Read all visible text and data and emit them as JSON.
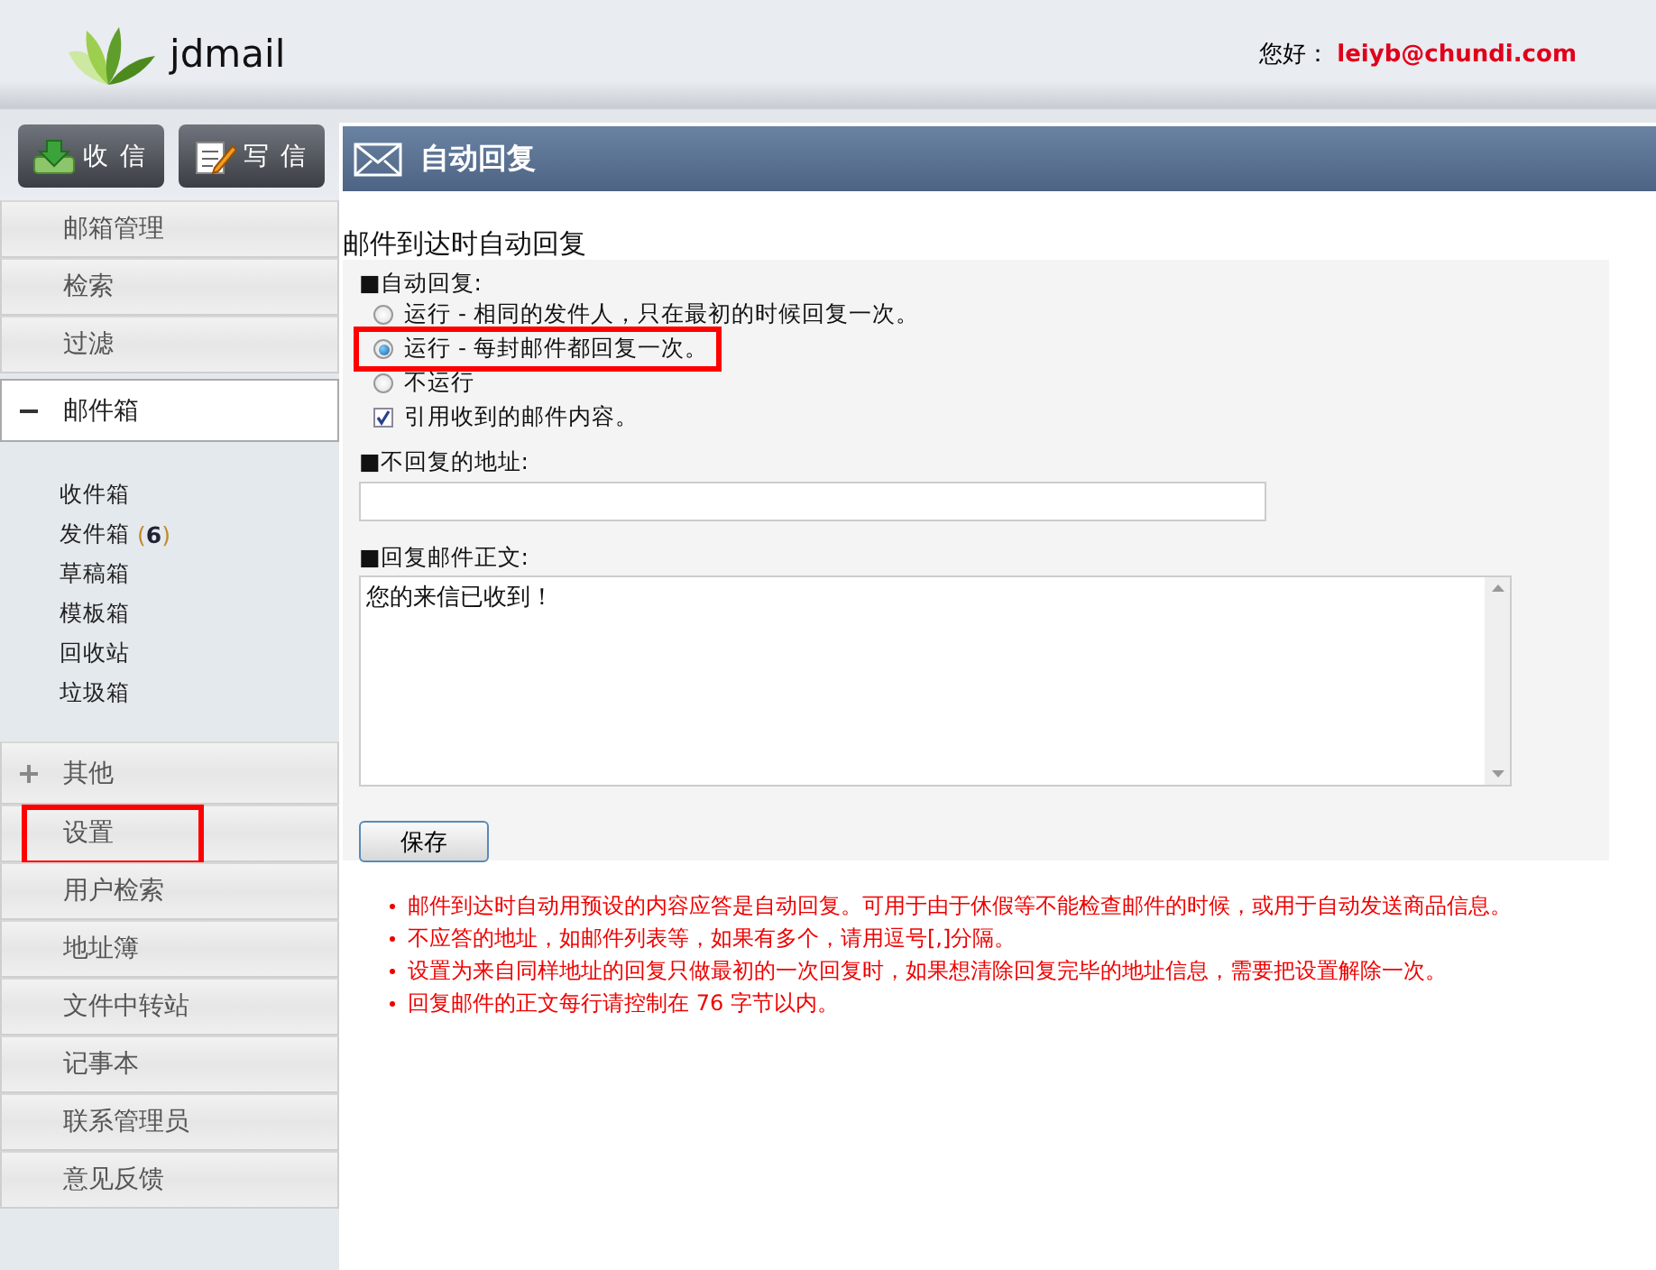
{
  "header": {
    "logo": "jdmail",
    "greeting": "您好：",
    "user": "leiyb@chundi.com"
  },
  "toolbar": [
    {
      "kind": "inbox",
      "label": "收 信"
    },
    {
      "kind": "compose",
      "label": "写 信"
    }
  ],
  "sidebar": [
    {
      "label": "邮箱管理"
    },
    {
      "label": "检索"
    },
    {
      "label": "过滤"
    },
    {
      "label": "邮件箱",
      "expanded": true,
      "children": [
        {
          "label": "收件箱"
        },
        {
          "label": "发件箱",
          "count": "(**6**)"
        },
        {
          "label": "草稿箱"
        },
        {
          "label": "模板箱"
        },
        {
          "label": "回收站"
        },
        {
          "label": "垃圾箱"
        }
      ]
    },
    {
      "label": "其他",
      "expanded": false
    },
    {
      "label": "设置",
      "highlighted": true
    },
    {
      "label": "用户检索"
    },
    {
      "label": "地址簿"
    },
    {
      "label": "文件中转站"
    },
    {
      "label": "记事本"
    },
    {
      "label": "联系管理员"
    },
    {
      "label": "意见反馈"
    }
  ],
  "panel": {
    "title": "自动回复",
    "heading": "邮件到达时自动回复",
    "reply_label": "■自动回复:",
    "options": [
      {
        "kind": "radio",
        "label": "运行 - 相同的发件人，只在最初的时候回复一次。",
        "selected": false,
        "highlighted": false
      },
      {
        "kind": "radio",
        "label": "运行 - 每封邮件都回复一次。",
        "selected": true,
        "highlighted": true
      },
      {
        "kind": "radio",
        "label": "不运行",
        "selected": false,
        "highlighted": false
      },
      {
        "kind": "checkbox",
        "label": "引用收到的邮件内容。",
        "checked": true
      }
    ],
    "exclude_label": "■不回复的地址:",
    "body_label": "■回复邮件正文:",
    "body_value": "您的来信已收到！",
    "save_button": "保存",
    "notes": [
      "邮件到达时自动用预设的内容应答是自动回复。可用于由于休假等不能检查邮件的时候，或用于自动发送商品信息。",
      "不应答的地址，如邮件列表等，如果有多个，请用逗号[,]分隔。",
      "设置为来自同样地址的回复只做最初的一次回复时，如果想清除回复完毕的地址信息，需要把设置解除一次。",
      "回复邮件的正文每行请控制在 76 字节以内。"
    ]
  }
}
